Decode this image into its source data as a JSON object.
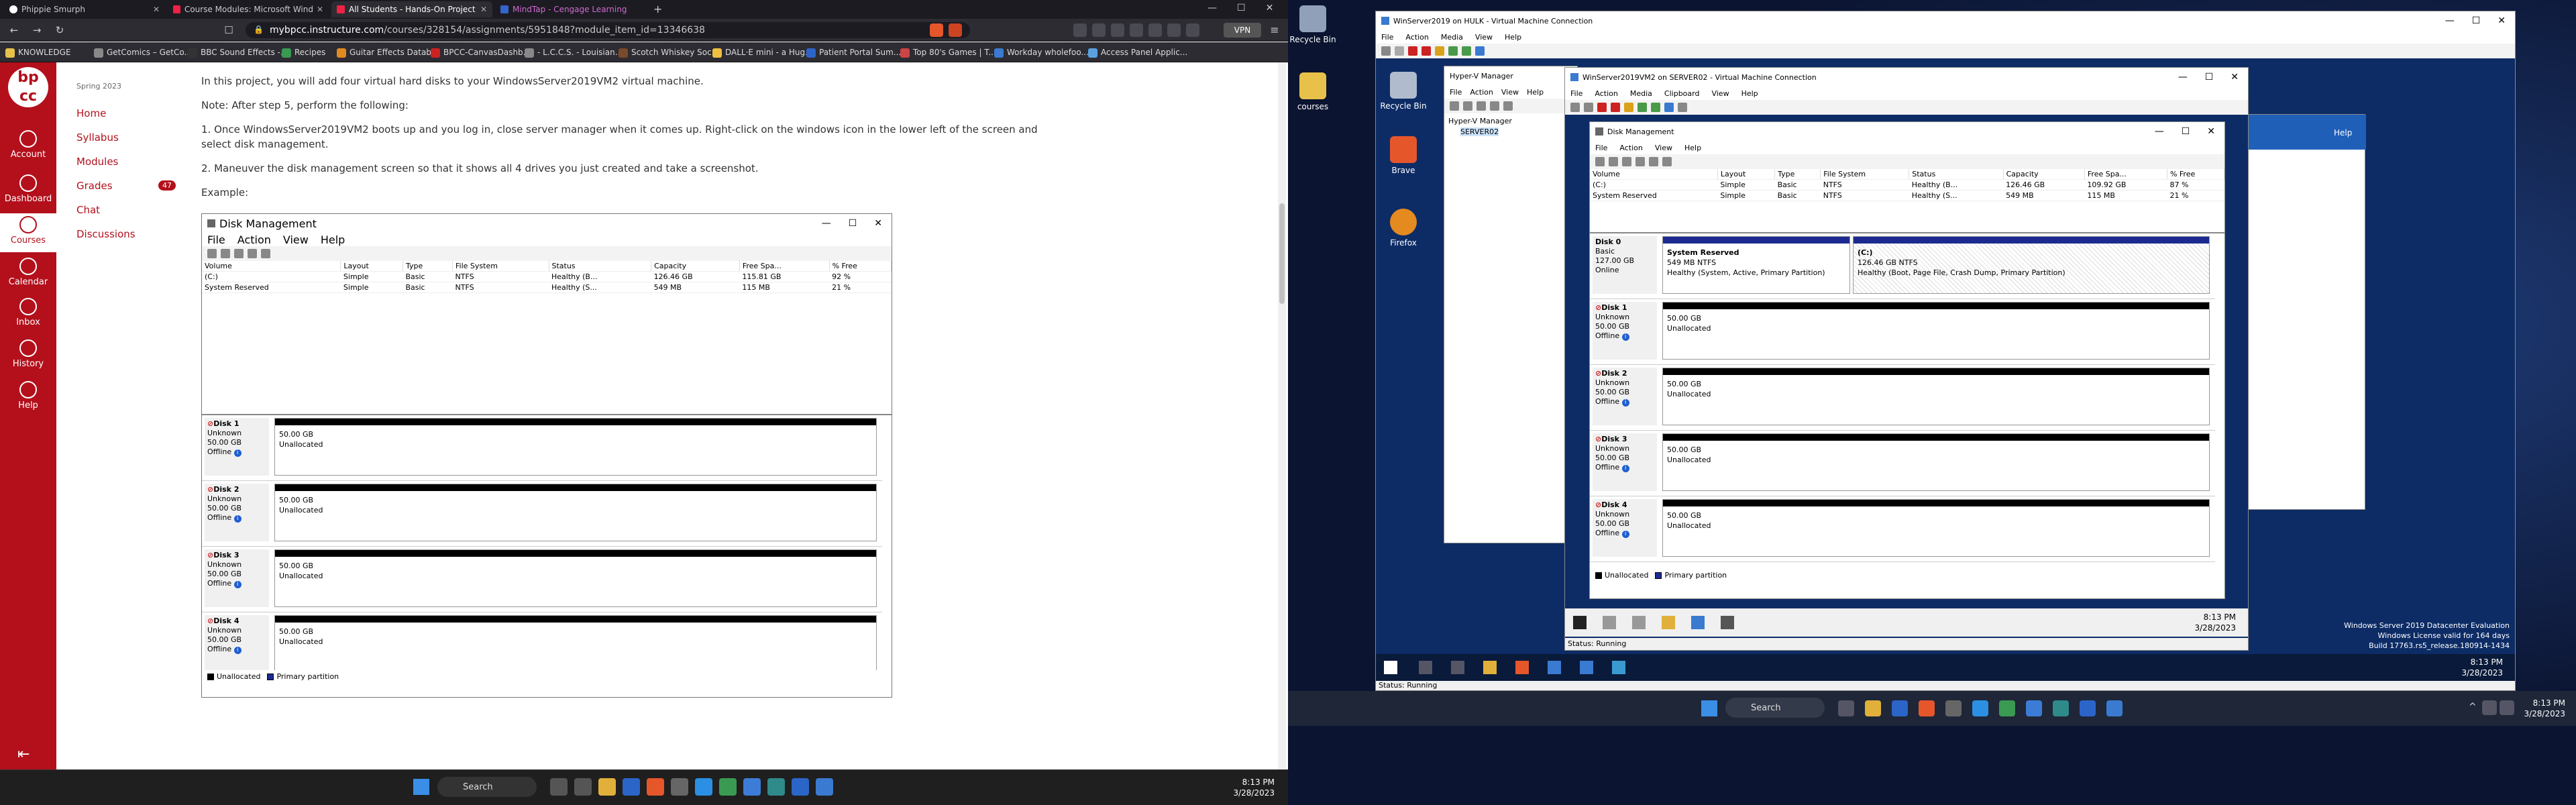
{
  "browser": {
    "tabs": [
      {
        "title": "Phippie Smurph"
      },
      {
        "title": "Course Modules: Microsoft Window"
      },
      {
        "title": "All Students - Hands-On Project"
      },
      {
        "title": "MindTap - Cengage Learning"
      }
    ],
    "url_prefix": "mybpcc.instructure.com",
    "url_rest": "/courses/328154/assignments/5951848?module_item_id=13346638",
    "vpn_label": "VPN",
    "bookmarks": [
      "KNOWLEDGE",
      "GetComics – GetCo...",
      "BBC Sound Effects -...",
      "Recipes",
      "Guitar Effects Datab...",
      "BPCC-CanvasDashb...",
      "- L.C.C.S. - Louisian...",
      "Scotch Whiskey Soc...",
      "DALL·E mini - a Hug...",
      "Patient Portal Sum...",
      "Top 80's Games | T...",
      "Workday wholefoo...",
      "Access Panel Applic..."
    ]
  },
  "canvas": {
    "logo": "bp\ncc",
    "nav": [
      {
        "label": "Account"
      },
      {
        "label": "Dashboard"
      },
      {
        "label": "Courses"
      },
      {
        "label": "Calendar"
      },
      {
        "label": "Inbox"
      },
      {
        "label": "History"
      },
      {
        "label": "Help"
      }
    ],
    "term": "Spring 2023",
    "course_nav": [
      "Home",
      "Syllabus",
      "Modules",
      "Grades",
      "Chat",
      "Discussions"
    ],
    "grades_badge": "47",
    "paragraphs": [
      "In this project, you will add four virtual hard disks to your WindowsServer2019VM2 virtual machine.",
      "Note: After step 5, perform the following:",
      "1. Once WindowsServer2019VM2 boots up and you log in, close server manager when it comes up. Right-click on the windows icon in the lower left of the screen and select disk management.",
      "2. Maneuver the disk management screen so that it shows all 4 drives you just created and take a screenshot.",
      "Example:"
    ]
  },
  "diskmgmt_example": {
    "title": "Disk Management",
    "menus": [
      "File",
      "Action",
      "View",
      "Help"
    ],
    "columns": [
      "Volume",
      "Layout",
      "Type",
      "File System",
      "Status",
      "Capacity",
      "Free Spa...",
      "% Free"
    ],
    "rows": [
      [
        "(C:)",
        "Simple",
        "Basic",
        "NTFS",
        "Healthy (B...",
        "126.46 GB",
        "115.81 GB",
        "92 %"
      ],
      [
        "System Reserved",
        "Simple",
        "Basic",
        "NTFS",
        "Healthy (S...",
        "549 MB",
        "115 MB",
        "21 %"
      ]
    ],
    "disks": [
      {
        "name": "Disk 1",
        "type": "Unknown",
        "size": "50.00 GB",
        "state": "Offline",
        "part_size": "50.00 GB",
        "part_label": "Unallocated"
      },
      {
        "name": "Disk 2",
        "type": "Unknown",
        "size": "50.00 GB",
        "state": "Offline",
        "part_size": "50.00 GB",
        "part_label": "Unallocated"
      },
      {
        "name": "Disk 3",
        "type": "Unknown",
        "size": "50.00 GB",
        "state": "Offline",
        "part_size": "50.00 GB",
        "part_label": "Unallocated"
      },
      {
        "name": "Disk 4",
        "type": "Unknown",
        "size": "50.00 GB",
        "state": "Offline",
        "part_size": "50.00 GB",
        "part_label": "Unallocated"
      }
    ],
    "legend": [
      "Unallocated",
      "Primary partition"
    ]
  },
  "left_taskbar": {
    "search": "Search",
    "time": "8:13 PM",
    "date": "3/28/2023"
  },
  "right": {
    "desktop_icons": [
      "Recycle Bin",
      "courses",
      "Recycle Bin",
      "Brave",
      "Firefox"
    ],
    "host_vm_title": "WinServer2019 on HULK - Virtual Machine Connection",
    "host_vm_menus": [
      "File",
      "Action",
      "Media",
      "View",
      "Help"
    ],
    "hyperv_title": "Hyper-V Manager",
    "hyperv_menus": [
      "File",
      "Action",
      "View",
      "Help"
    ],
    "hyperv_tree": [
      "Hyper-V Manager",
      "SERVER02"
    ],
    "vm2_title": "WinServer2019VM2 on SERVER02 - Virtual Machine Connection",
    "vm2_menus": [
      "File",
      "Action",
      "Media",
      "Clipboard",
      "View",
      "Help"
    ],
    "dm": {
      "title": "Disk Management",
      "menus": [
        "File",
        "Action",
        "View",
        "Help"
      ],
      "columns": [
        "Volume",
        "Layout",
        "Type",
        "File System",
        "Status",
        "Capacity",
        "Free Spa...",
        "% Free"
      ],
      "rows": [
        [
          "(C:)",
          "Simple",
          "Basic",
          "NTFS",
          "Healthy (B...",
          "126.46 GB",
          "109.92 GB",
          "87 %"
        ],
        [
          "System Reserved",
          "Simple",
          "Basic",
          "NTFS",
          "Healthy (S...",
          "549 MB",
          "115 MB",
          "21 %"
        ]
      ],
      "disk0": {
        "name": "Disk 0",
        "type": "Basic",
        "size": "127.00 GB",
        "state": "Online",
        "p1_name": "System Reserved",
        "p1_size": "549 MB NTFS",
        "p1_status": "Healthy (System, Active, Primary Partition)",
        "p2_name": "(C:)",
        "p2_size": "126.46 GB NTFS",
        "p2_status": "Healthy (Boot, Page File, Crash Dump, Primary Partition)"
      },
      "disks": [
        {
          "name": "Disk 1",
          "type": "Unknown",
          "size": "50.00 GB",
          "state": "Offline",
          "part_size": "50.00 GB",
          "part_label": "Unallocated"
        },
        {
          "name": "Disk 2",
          "type": "Unknown",
          "size": "50.00 GB",
          "state": "Offline",
          "part_size": "50.00 GB",
          "part_label": "Unallocated"
        },
        {
          "name": "Disk 3",
          "type": "Unknown",
          "size": "50.00 GB",
          "state": "Offline",
          "part_size": "50.00 GB",
          "part_label": "Unallocated"
        },
        {
          "name": "Disk 4",
          "type": "Unknown",
          "size": "50.00 GB",
          "state": "Offline",
          "part_size": "50.00 GB",
          "part_label": "Unallocated"
        }
      ],
      "legend": [
        "Unallocated",
        "Primary partition"
      ]
    },
    "vm_taskbar_time": "8:13 PM",
    "vm_taskbar_date": "3/28/2023",
    "vm2_status": "Status: Running",
    "host_status": "Status: Running",
    "watermark": [
      "Windows Server 2019 Datacenter Evaluation",
      "Windows License valid for 164 days",
      "Build 17763.rs5_release.180914-1434"
    ],
    "host_vm_time": "8:13 PM",
    "host_vm_date": "3/28/2023",
    "help_label": "Help",
    "taskbar_search": "Search",
    "time": "8:13 PM",
    "date": "3/28/2023"
  }
}
